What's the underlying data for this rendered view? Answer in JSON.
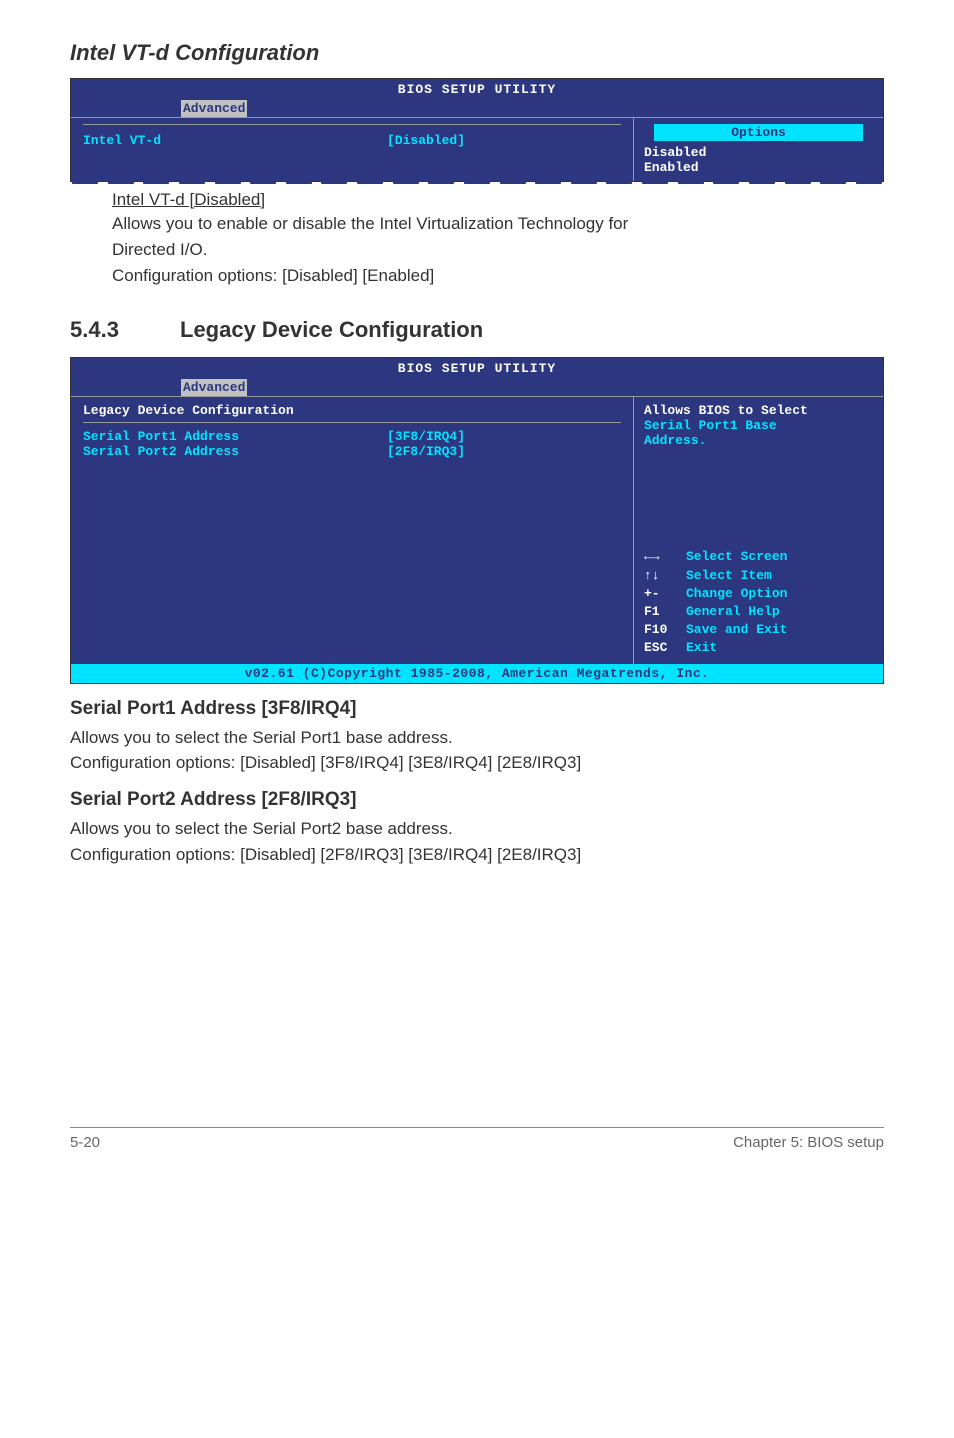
{
  "section1": {
    "title": "Intel VT-d Configuration",
    "bios": {
      "header": "BIOS SETUP UTILITY",
      "tab": "Advanced",
      "item_label": "Intel VT-d",
      "item_value": "[Disabled]",
      "options_title": "Options",
      "option1": "Disabled",
      "option2": "Enabled"
    },
    "sub_title": "Intel VT-d [Disabled]",
    "desc_line1": "Allows you to enable or disable the Intel Virtualization Technology for",
    "desc_line2": "Directed I/O.",
    "desc_line3": "Configuration options: [Disabled] [Enabled]"
  },
  "section2": {
    "num": "5.4.3",
    "title": "Legacy Device Configuration",
    "bios": {
      "header": "BIOS SETUP UTILITY",
      "tab": "Advanced",
      "panel_title": "Legacy Device Configuration",
      "row1_label": "Serial Port1 Address",
      "row1_value": "[3F8/IRQ4]",
      "row2_label": "Serial Port2 Address",
      "row2_value": "[2F8/IRQ3]",
      "help_line1": "Allows BIOS to Select",
      "help_line2": "Serial Port1 Base",
      "help_line3": "Address.",
      "keys": {
        "arrows": "Select Screen",
        "updown": "Select Item",
        "plusminus": "Change Option",
        "f1": "General Help",
        "f10": "Save and Exit",
        "esc": "Exit"
      },
      "footer": "v02.61 (C)Copyright 1985-2008, American Megatrends, Inc."
    },
    "sub1": {
      "title": "Serial Port1 Address [3F8/IRQ4]",
      "desc1": "Allows you to select the Serial Port1 base address.",
      "desc2": "Configuration options: [Disabled] [3F8/IRQ4] [3E8/IRQ4] [2E8/IRQ3]"
    },
    "sub2": {
      "title": "Serial Port2 Address [2F8/IRQ3]",
      "desc1": "Allows you to select the Serial Port2 base address.",
      "desc2": "Configuration options: [Disabled] [2F8/IRQ3] [3E8/IRQ4] [2E8/IRQ3]"
    }
  },
  "footer": {
    "left": "5-20",
    "right": "Chapter 5: BIOS setup"
  }
}
